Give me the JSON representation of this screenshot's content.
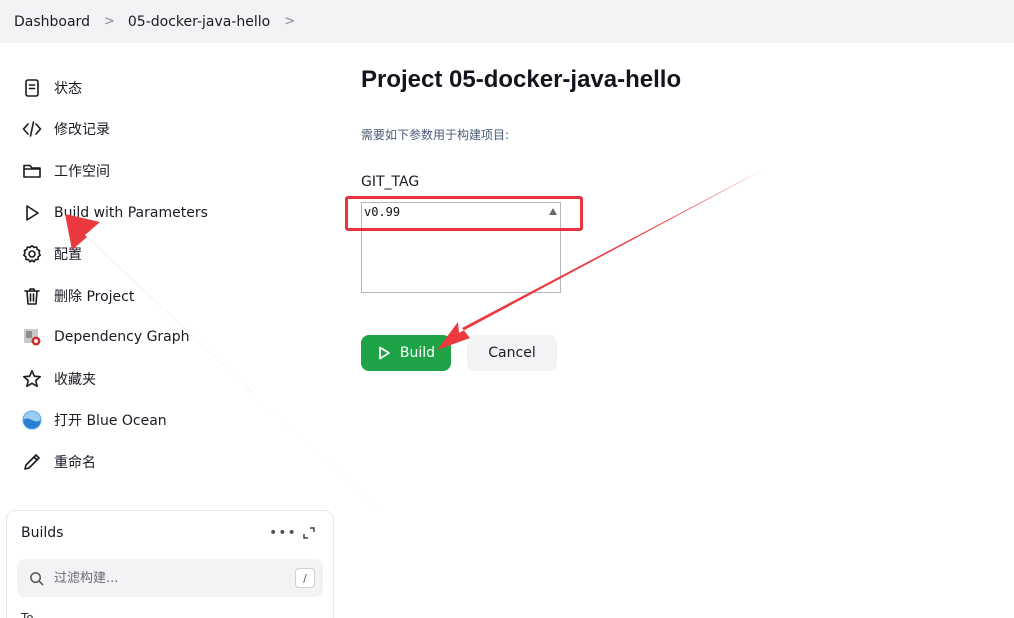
{
  "breadcrumb": {
    "items": [
      "Dashboard",
      "05-docker-java-hello"
    ],
    "separator": ">"
  },
  "sidebar": {
    "items": [
      {
        "label": "状态",
        "icon": "document-icon"
      },
      {
        "label": "修改记录",
        "icon": "code-icon"
      },
      {
        "label": "工作空间",
        "icon": "folder-icon"
      },
      {
        "label": "Build with Parameters",
        "icon": "play-icon"
      },
      {
        "label": "配置",
        "icon": "gear-icon"
      },
      {
        "label": "删除 Project",
        "icon": "trash-icon"
      },
      {
        "label": "Dependency Graph",
        "icon": "dependency-graph-icon"
      },
      {
        "label": "收藏夹",
        "icon": "star-icon"
      },
      {
        "label": "打开 Blue Ocean",
        "icon": "blue-ocean-icon"
      },
      {
        "label": "重命名",
        "icon": "pencil-icon"
      }
    ]
  },
  "builds": {
    "title": "Builds",
    "more": "•••",
    "filter_placeholder": "过滤构建...",
    "shortcut": "/",
    "cut_text": "To"
  },
  "main": {
    "title": "Project 05-docker-java-hello",
    "description": "需要如下参数用于构建项目:",
    "parameter": {
      "name": "GIT_TAG",
      "value": "v0.99"
    },
    "build_label": "Build",
    "cancel_label": "Cancel"
  },
  "colors": {
    "build_button": "#1ea446",
    "annotation": "#e8323c",
    "topbar": "#f3f3f5"
  }
}
